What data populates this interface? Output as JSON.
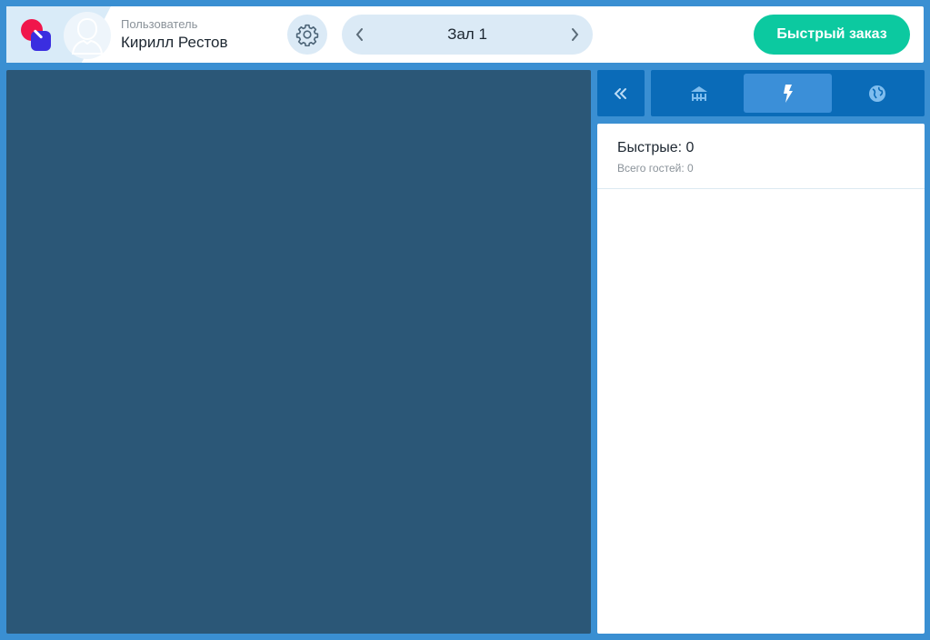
{
  "header": {
    "user_caption": "Пользователь",
    "user_name": "Кирилл Рестов",
    "hall_name": "Зал 1",
    "quick_order_label": "Быстрый заказ"
  },
  "icons": {
    "logo": "app-logo",
    "avatar": "user-silhouette-icon",
    "settings": "gear-icon",
    "prev": "chevron-left-icon",
    "next": "chevron-right-icon",
    "collapse": "double-chevron-left-icon",
    "tab_hall": "tables-icon",
    "tab_quick": "lightning-icon",
    "tab_online": "globe-icon"
  },
  "tabs": [
    {
      "id": "hall",
      "active": false
    },
    {
      "id": "quick",
      "active": true
    },
    {
      "id": "online",
      "active": false
    }
  ],
  "panel": {
    "title": "Быстрые: 0",
    "subtitle": "Всего гостей: 0"
  },
  "colors": {
    "background": "#3a8fd2",
    "accent_green": "#0cc9a0",
    "floor": "#2b5777",
    "tab_bar": "#0a6bb8",
    "tab_active": "#3b8fd8"
  }
}
